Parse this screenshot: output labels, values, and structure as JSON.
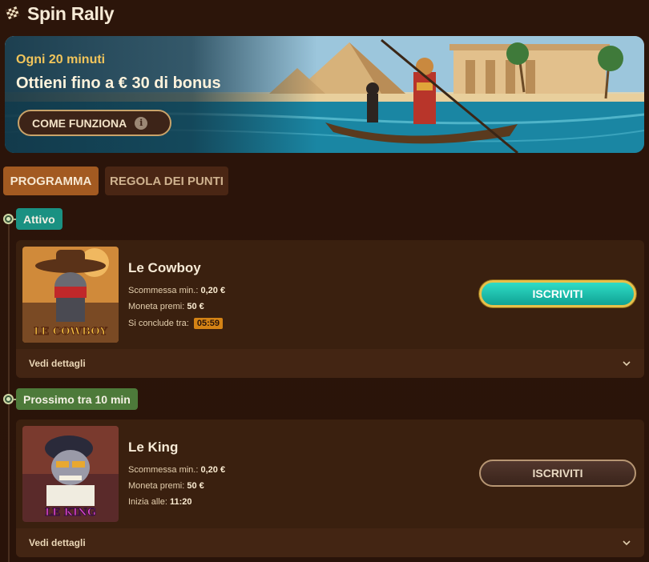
{
  "app": {
    "title": "Spin Rally",
    "icon": "checkered-flag-icon"
  },
  "banner": {
    "subtitle": "Ogni 20 minuti",
    "headline": "Ottieni fino a € 30 di bonus",
    "how_button": "COME FUNZIONA",
    "how_icon": "info-icon"
  },
  "tabs": [
    {
      "label": "PROGRAMMA",
      "active": true
    },
    {
      "label": "REGOLA DEI PUNTI",
      "active": false
    }
  ],
  "tournaments": [
    {
      "status": "Attivo",
      "game": "Le Cowboy",
      "thumb_text": "LE COWBOY",
      "min_bet_label": "Scommessa min.:",
      "min_bet": "0,20 €",
      "prize_label": "Moneta premi:",
      "prize": "50 €",
      "time_label": "Si conclude tra:",
      "time": "05:59",
      "join_button": "ISCRIVITI",
      "details": "Vedi dettagli"
    },
    {
      "status": "Prossimo tra 10 min",
      "game": "Le King",
      "thumb_text": "LE KING",
      "min_bet_label": "Scommessa min.:",
      "min_bet": "0,20 €",
      "prize_label": "Moneta premi:",
      "prize": "50 €",
      "time_label": "Inizia alle:",
      "time": "11:20",
      "join_button": "ISCRIVITI",
      "details": "Vedi dettagli"
    }
  ],
  "colors": {
    "background": "#2a1409",
    "accent_teal": "#1a9182",
    "accent_gold": "#e6c04a",
    "tab_active": "#a35a21",
    "timer": "#d48315"
  }
}
